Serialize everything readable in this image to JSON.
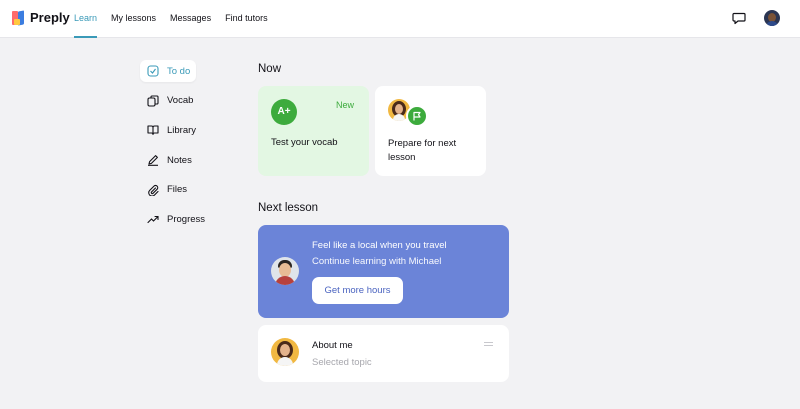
{
  "header": {
    "logo_text": "Preply",
    "nav": [
      {
        "label": "Learn",
        "active": true
      },
      {
        "label": "My lessons",
        "active": false
      },
      {
        "label": "Messages",
        "active": false
      },
      {
        "label": "Find tutors",
        "active": false
      }
    ],
    "icons": [
      "chat-bubble-icon",
      "user-avatar"
    ]
  },
  "sidebar": {
    "items": [
      {
        "label": "To do",
        "icon": "check-square-icon",
        "active": true
      },
      {
        "label": "Vocab",
        "icon": "cards-icon",
        "active": false
      },
      {
        "label": "Library",
        "icon": "book-icon",
        "active": false
      },
      {
        "label": "Notes",
        "icon": "pen-icon",
        "active": false
      },
      {
        "label": "Files",
        "icon": "paperclip-icon",
        "active": false
      },
      {
        "label": "Progress",
        "icon": "trend-up-icon",
        "active": false
      }
    ]
  },
  "now": {
    "title": "Now",
    "vocab_card": {
      "badge": "A+",
      "tag": "New",
      "title": "Test your vocab"
    },
    "prepare_card": {
      "title": "Prepare for next lesson"
    }
  },
  "next_lesson": {
    "title": "Next lesson",
    "promo": {
      "title": "Feel like a local when you travel",
      "subtitle": "Continue learning with Michael",
      "button": "Get more hours"
    },
    "topic": {
      "title": "About me",
      "subtitle": "Selected topic"
    }
  },
  "colors": {
    "accent": "#3a9ab8",
    "green": "#3dab3d",
    "promo_bg": "#6b84d8",
    "vocab_bg": "#e3f7e3"
  }
}
